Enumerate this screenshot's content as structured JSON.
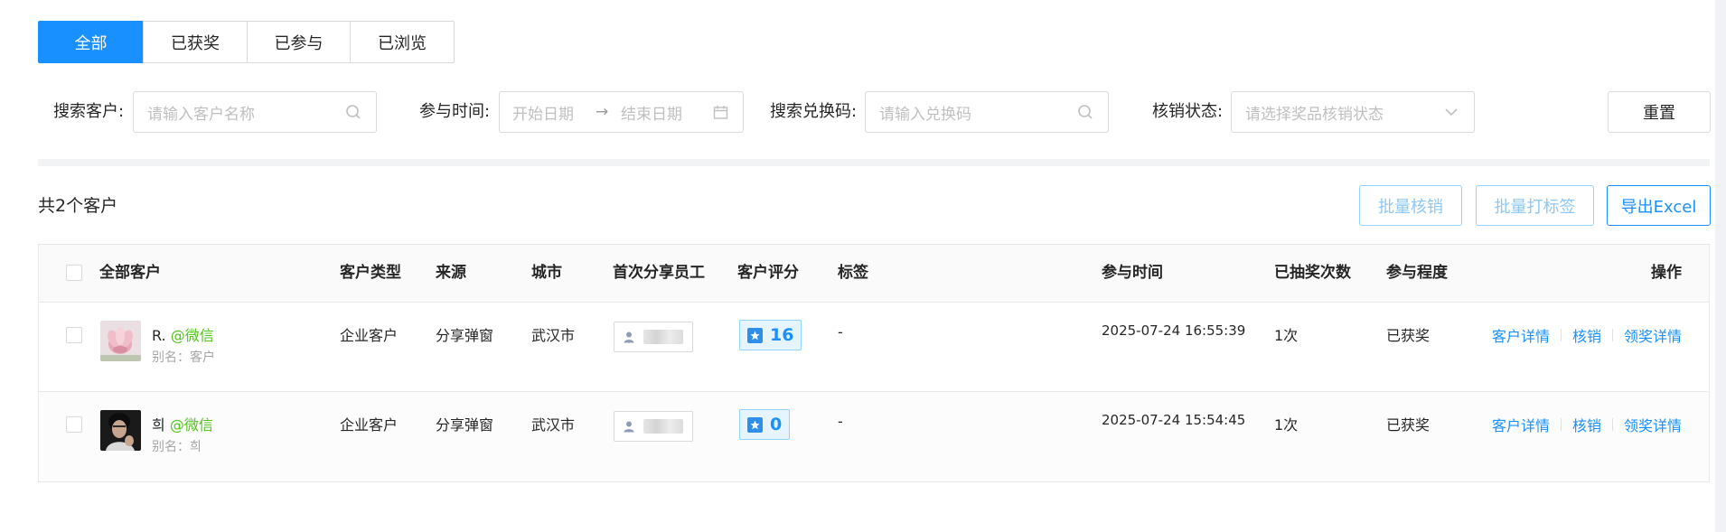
{
  "tabs": [
    "全部",
    "已获奖",
    "已参与",
    "已浏览"
  ],
  "filters": {
    "customer_label": "搜索客户:",
    "customer_placeholder": "请输入客户名称",
    "time_label": "参与时间:",
    "start_placeholder": "开始日期",
    "range_arrow": "→",
    "end_placeholder": "结束日期",
    "code_label": "搜索兑换码:",
    "code_placeholder": "请输入兑换码",
    "status_label": "核销状态:",
    "status_placeholder": "请选择奖品核销状态",
    "reset_label": "重置"
  },
  "summary": {
    "count_text": "共2个客户"
  },
  "actions": {
    "batch_verify": "批量核销",
    "batch_tag": "批量打标签",
    "export": "导出Excel"
  },
  "table": {
    "headers": {
      "customer": "全部客户",
      "type": "客户类型",
      "source": "来源",
      "city": "城市",
      "staff": "首次分享员工",
      "score": "客户评分",
      "tags": "标签",
      "time": "参与时间",
      "draws": "已抽奖次数",
      "level": "参与程度",
      "ops": "操作"
    },
    "rows": [
      {
        "name": "R.",
        "wechat": "@微信",
        "alias": "别名：客户",
        "type": "企业客户",
        "source": "分享弹窗",
        "city": "武汉市",
        "score": "16",
        "tags": "-",
        "time": "2025-07-24 16:55:39",
        "draws": "1次",
        "level": "已获奖",
        "op_detail": "客户详情",
        "op_verify": "核销",
        "op_prize": "领奖详情"
      },
      {
        "name": "희",
        "wechat": "@微信",
        "alias": "别名：희",
        "type": "企业客户",
        "source": "分享弹窗",
        "city": "武汉市",
        "score": "0",
        "tags": "-",
        "time": "2025-07-24 15:54:45",
        "draws": "1次",
        "level": "已获奖",
        "op_detail": "客户详情",
        "op_verify": "核销",
        "op_prize": "领奖详情"
      }
    ]
  },
  "colors": {
    "primary": "#1890ff",
    "wechat": "#52c41a"
  },
  "icons": [
    "search-icon",
    "calendar-icon",
    "chevron-down-icon",
    "user-icon",
    "star-badge-icon"
  ]
}
